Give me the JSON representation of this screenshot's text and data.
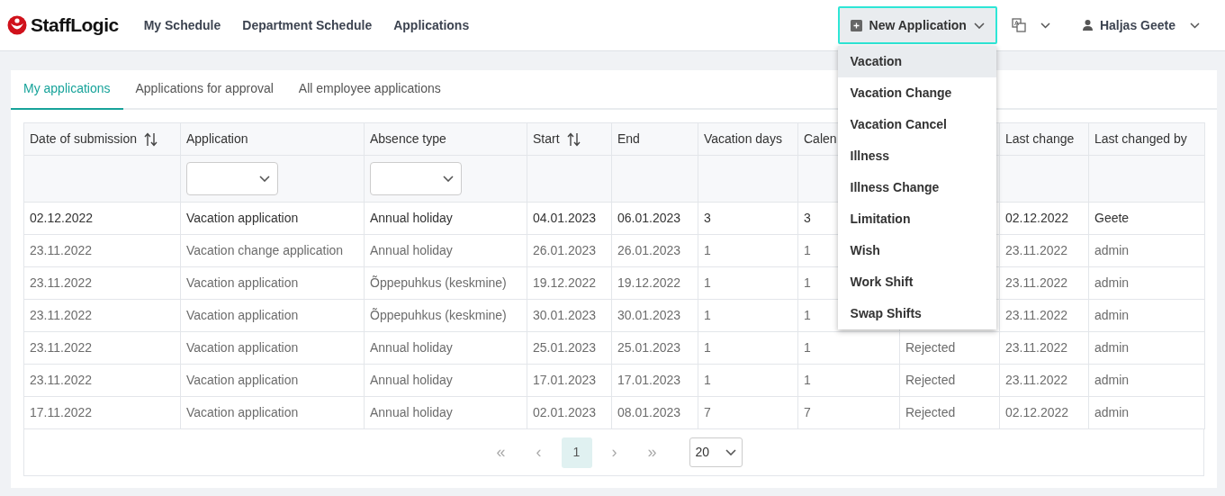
{
  "navbar": {
    "brand": "StaffLogic",
    "links": [
      "My Schedule",
      "Department Schedule",
      "Applications"
    ],
    "new_button": {
      "label": "New Application",
      "expanded": true
    },
    "user": {
      "name": "Haljas Geete"
    }
  },
  "new_menu": [
    {
      "label": "Vacation",
      "highlighted": true
    },
    {
      "label": "Vacation Change",
      "highlighted": false
    },
    {
      "label": "Vacation Cancel",
      "highlighted": false
    },
    {
      "label": "Illness",
      "highlighted": false
    },
    {
      "label": "Illness Change",
      "highlighted": false
    },
    {
      "label": "Limitation",
      "highlighted": false
    },
    {
      "label": "Wish",
      "highlighted": false
    },
    {
      "label": "Work Shift",
      "highlighted": false
    },
    {
      "label": "Swap Shifts",
      "highlighted": false
    }
  ],
  "tabs": [
    {
      "label": "My applications",
      "selected": true
    },
    {
      "label": "Applications for approval",
      "selected": false
    },
    {
      "label": "All employee applications",
      "selected": false
    }
  ],
  "table": {
    "columns": [
      {
        "label": "Date of submission",
        "sortable": true,
        "filter": false
      },
      {
        "label": "Application",
        "sortable": false,
        "filter": true
      },
      {
        "label": "Absence type",
        "sortable": false,
        "filter": true
      },
      {
        "label": "Start",
        "sortable": true,
        "filter": false
      },
      {
        "label": "End",
        "sortable": false,
        "filter": false
      },
      {
        "label": "Vacation days",
        "sortable": false,
        "filter": false
      },
      {
        "label": "Calen",
        "filter": false
      },
      {
        "filter": false
      },
      {
        "label": "Last change",
        "sortable": false,
        "filter": false
      },
      {
        "label": "Last changed by",
        "sortable": false,
        "filter": false
      }
    ],
    "rows": [
      {
        "dimmed": false,
        "cells": [
          "02.12.2022",
          "Vacation application",
          "Annual holiday",
          "04.01.2023",
          "06.01.2023",
          "3",
          "3",
          null,
          "02.12.2022",
          "Geete"
        ]
      },
      {
        "dimmed": true,
        "cells": [
          "23.11.2022",
          "Vacation change application",
          "Annual holiday",
          "26.01.2023",
          "26.01.2023",
          "1",
          "1",
          null,
          "23.11.2022",
          "admin"
        ]
      },
      {
        "dimmed": true,
        "cells": [
          "23.11.2022",
          "Vacation application",
          "Õppepuhkus (keskmine)",
          "19.12.2022",
          "19.12.2022",
          "1",
          "1",
          null,
          "23.11.2022",
          "admin"
        ]
      },
      {
        "dimmed": true,
        "cells": [
          "23.11.2022",
          "Vacation application",
          "Õppepuhkus (keskmine)",
          "30.01.2023",
          "30.01.2023",
          "1",
          "1",
          null,
          "23.11.2022",
          "admin"
        ]
      },
      {
        "dimmed": true,
        "cells": [
          "23.11.2022",
          "Vacation application",
          "Annual holiday",
          "25.01.2023",
          "25.01.2023",
          "1",
          "1",
          "Rejected",
          "23.11.2022",
          "admin"
        ]
      },
      {
        "dimmed": true,
        "cells": [
          "23.11.2022",
          "Vacation application",
          "Annual holiday",
          "17.01.2023",
          "17.01.2023",
          "1",
          "1",
          "Rejected",
          "23.11.2022",
          "admin"
        ]
      },
      {
        "dimmed": true,
        "cells": [
          "17.11.2022",
          "Vacation application",
          "Annual holiday",
          "02.01.2023",
          "08.01.2023",
          "7",
          "7",
          "Rejected",
          "02.12.2022",
          "admin"
        ]
      }
    ]
  },
  "pagination": {
    "first": "«",
    "prev": "‹",
    "pages": [
      {
        "label": "1",
        "selected": true
      }
    ],
    "next": "›",
    "last": "»",
    "page_size": "20"
  }
}
